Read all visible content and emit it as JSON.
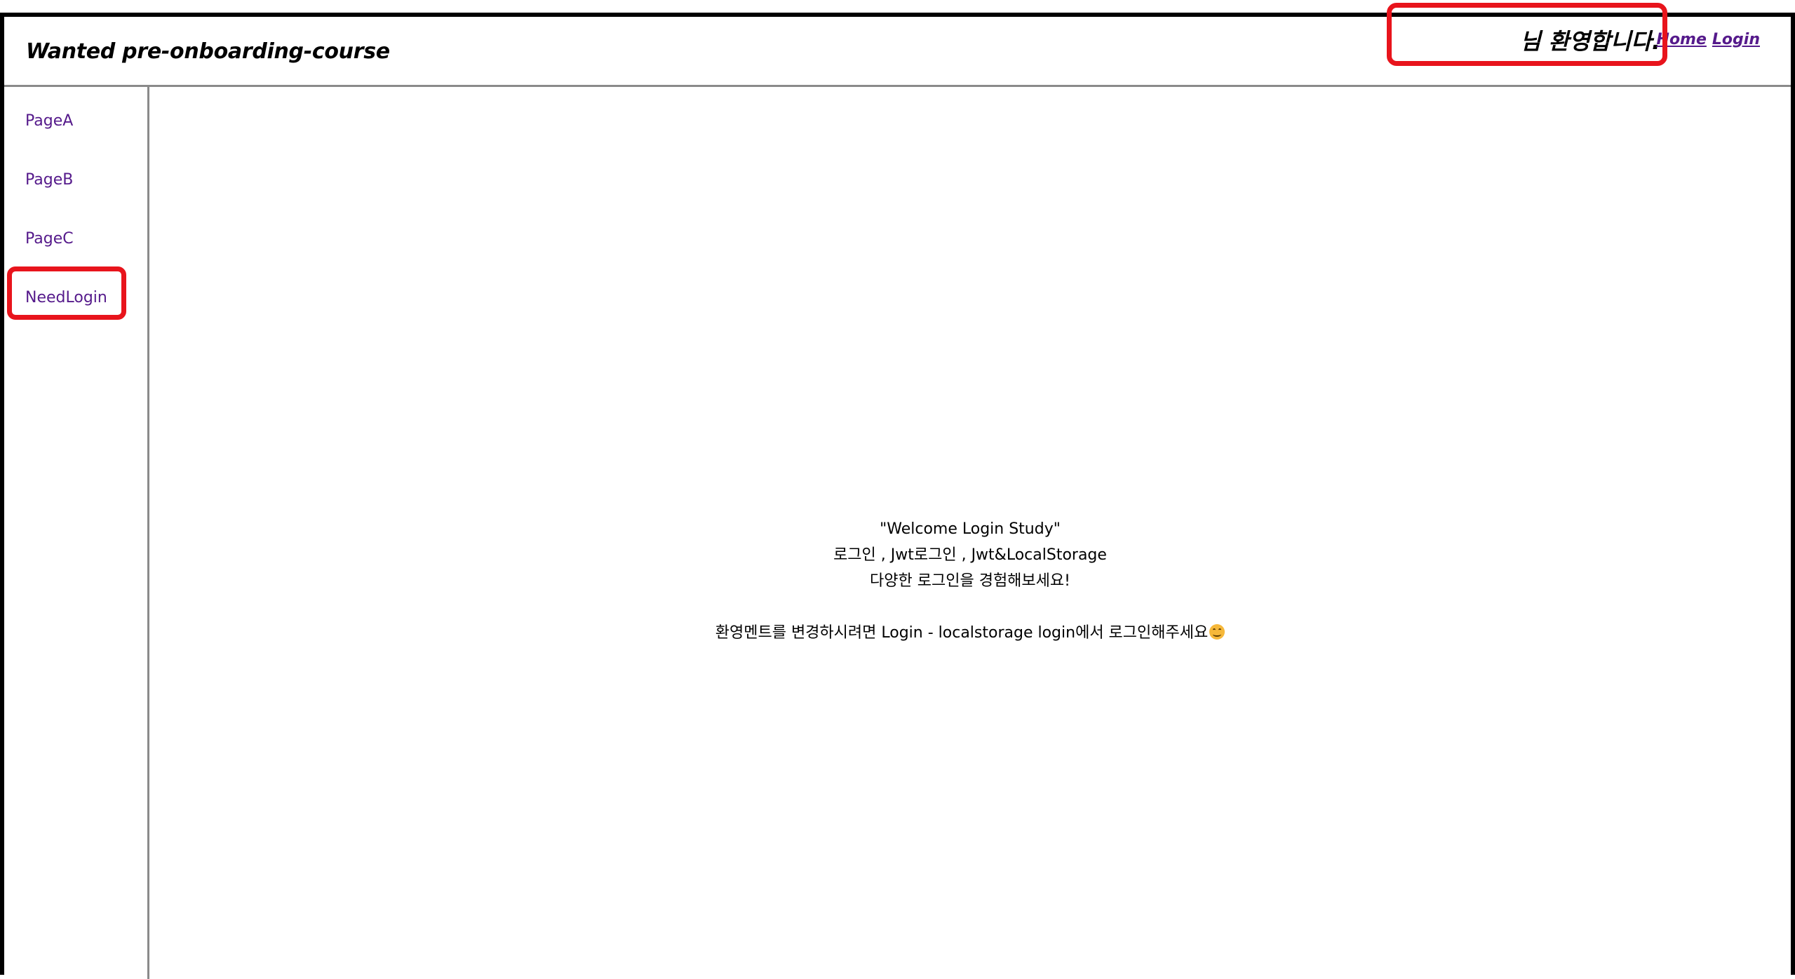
{
  "header": {
    "brand": "Wanted pre-onboarding-course",
    "greeting": "님 환영합니다.",
    "nav": {
      "home": "Home",
      "login": "Login"
    }
  },
  "sidebar": {
    "items": [
      {
        "label": "PageA"
      },
      {
        "label": "PageB"
      },
      {
        "label": "PageC"
      },
      {
        "label": "NeedLogin"
      }
    ]
  },
  "main": {
    "welcome_lines": [
      "\"Welcome Login Study\"",
      "로그인 , Jwt로그인 , Jwt&LocalStorage",
      "다양한 로그인을 경험해보세요!"
    ],
    "instruction": "환영멘트를 변경하시려면 Login - localstorage login에서 로그인해주세요",
    "instruction_icon": "smiling-face-icon"
  },
  "colors": {
    "link": "#551a8b",
    "annotation": "#e8141c",
    "divider": "#8a8a8a"
  }
}
